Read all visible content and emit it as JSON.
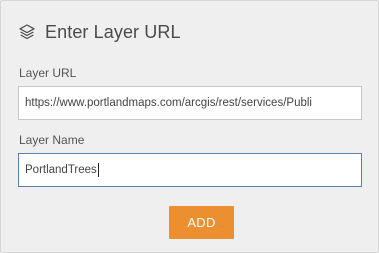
{
  "dialog": {
    "title": "Enter Layer URL",
    "title_icon": "layers-icon"
  },
  "layer_url": {
    "label": "Layer URL",
    "value": "https://www.portlandmaps.com/arcgis/rest/services/Publi"
  },
  "layer_name": {
    "label": "Layer Name",
    "value": "PortlandTrees"
  },
  "actions": {
    "add_label": "ADD"
  },
  "colors": {
    "panel_background": "#efefef",
    "accent_button": "#ec8f31",
    "focused_border": "#5b7fa8",
    "title_text": "#4a4a4a"
  }
}
